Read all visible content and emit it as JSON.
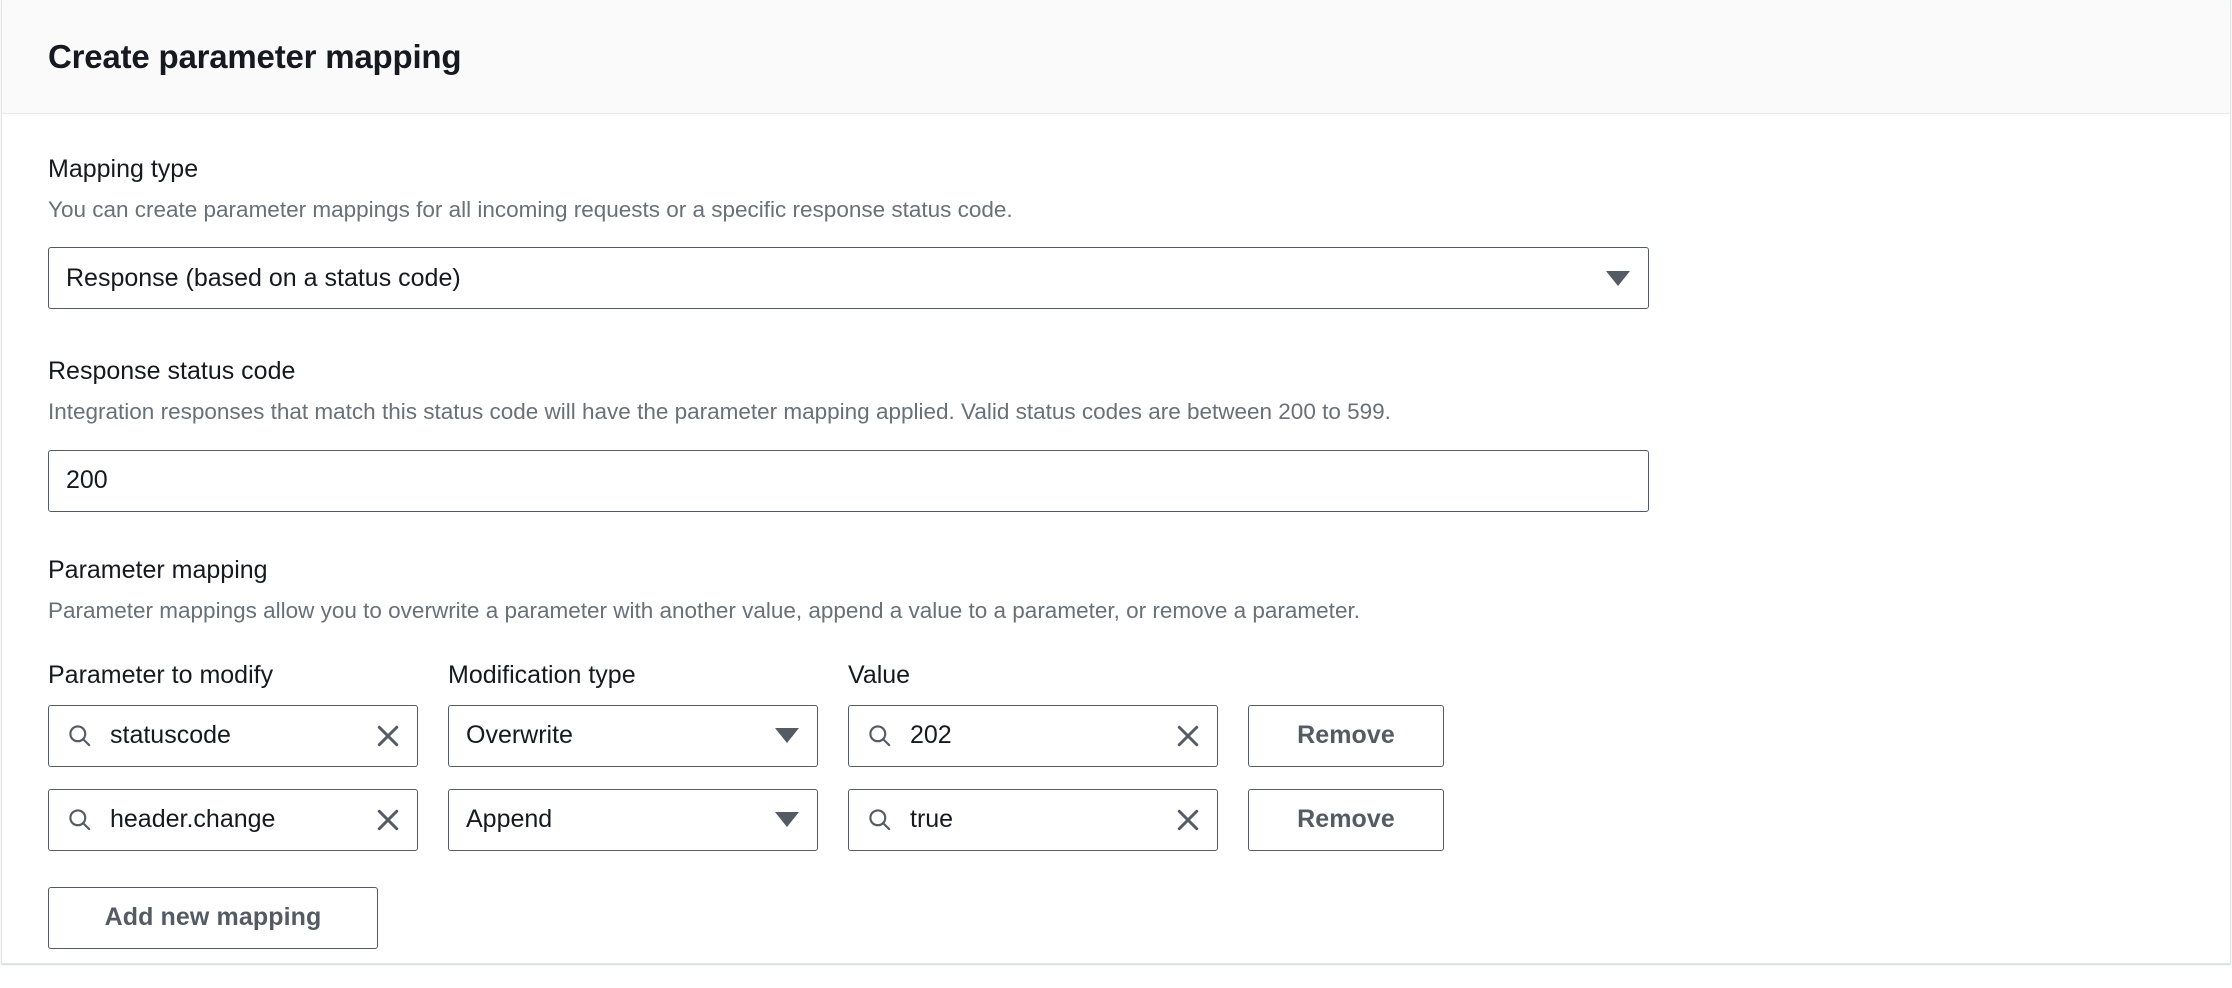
{
  "header": {
    "title": "Create parameter mapping"
  },
  "mapping_type": {
    "label": "Mapping type",
    "description": "You can create parameter mappings for all incoming requests or a specific response status code.",
    "selected": "Response (based on a status code)",
    "caret_icon": "chevron-down-icon"
  },
  "response_status_code": {
    "label": "Response status code",
    "description": "Integration responses that match this status code will have the parameter mapping applied. Valid status codes are between 200 to 599.",
    "value": "200",
    "placeholder": ""
  },
  "parameter_mapping": {
    "label": "Parameter mapping",
    "description": "Parameter mappings allow you to overwrite a parameter with another value, append a value to a parameter, or remove a parameter.",
    "columns": {
      "parameter": "Parameter to modify",
      "modification": "Modification type",
      "value": "Value"
    },
    "rows": [
      {
        "parameter": "statuscode",
        "parameter_search_icon": "search-icon",
        "parameter_clear_icon": "close-icon",
        "modification": "Overwrite",
        "modification_caret_icon": "chevron-down-icon",
        "value": "202",
        "value_search_icon": "search-icon",
        "value_clear_icon": "close-icon",
        "remove_label": "Remove"
      },
      {
        "parameter": "header.change",
        "parameter_search_icon": "search-icon",
        "parameter_clear_icon": "close-icon",
        "modification": "Append",
        "modification_caret_icon": "chevron-down-icon",
        "value": "true",
        "value_search_icon": "search-icon",
        "value_clear_icon": "close-icon",
        "remove_label": "Remove"
      }
    ],
    "add_label": "Add new mapping"
  },
  "colors": {
    "border": "#545b64",
    "text": "#16191f",
    "muted": "#687078",
    "header_bg": "#fafafa",
    "panel_border": "#e3e6e8"
  }
}
